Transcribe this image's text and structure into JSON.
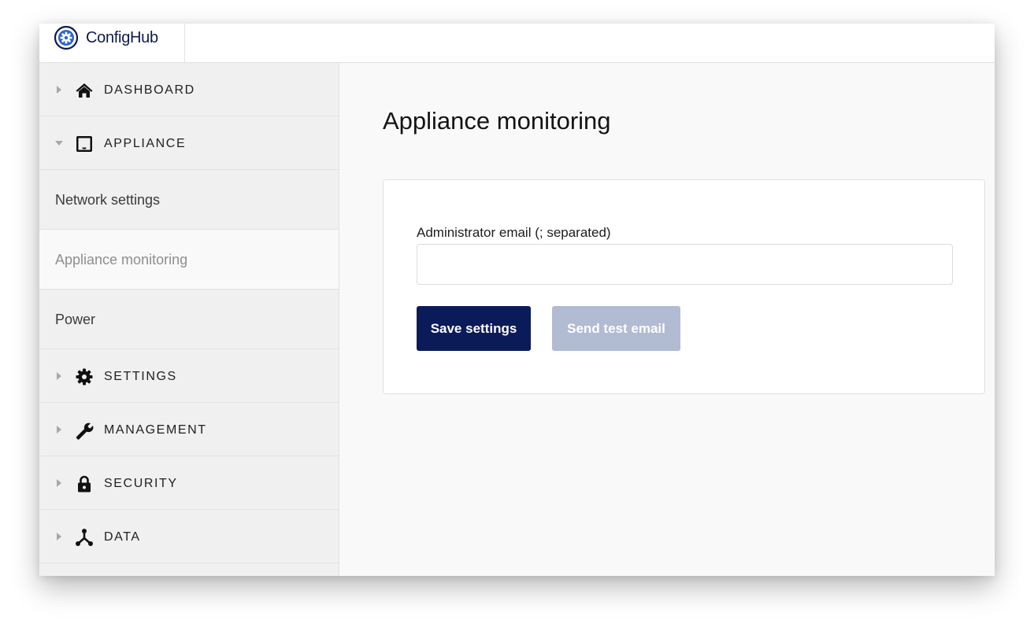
{
  "brand": {
    "name_prefix": "Config",
    "name_suffix": "Hub",
    "logo_icon": "gear-logo-icon",
    "color": "#0e1a4e"
  },
  "sidebar": {
    "sections": [
      {
        "label": "DASHBOARD",
        "icon": "home-icon",
        "expanded": false
      },
      {
        "label": "APPLIANCE",
        "icon": "inbox-icon",
        "expanded": true
      },
      {
        "label": "SETTINGS",
        "icon": "gear-icon",
        "expanded": false
      },
      {
        "label": "MANAGEMENT",
        "icon": "wrench-icon",
        "expanded": false
      },
      {
        "label": "SECURITY",
        "icon": "lock-icon",
        "expanded": false
      },
      {
        "label": "DATA",
        "icon": "network-icon",
        "expanded": false
      }
    ],
    "appliance_items": [
      {
        "label": "Network settings",
        "active": false
      },
      {
        "label": "Appliance monitoring",
        "active": true
      },
      {
        "label": "Power",
        "active": false
      }
    ]
  },
  "main": {
    "title": "Appliance monitoring",
    "form": {
      "email_label": "Administrator email (; separated)",
      "email_value": "",
      "email_placeholder": "",
      "save_label": "Save settings",
      "test_label": "Send test email"
    }
  },
  "colors": {
    "primary_button": "#0b1b5a",
    "disabled_button": "#b1bbd2",
    "sidebar_bg": "#f0f0f0",
    "content_bg": "#f9f9f9"
  }
}
